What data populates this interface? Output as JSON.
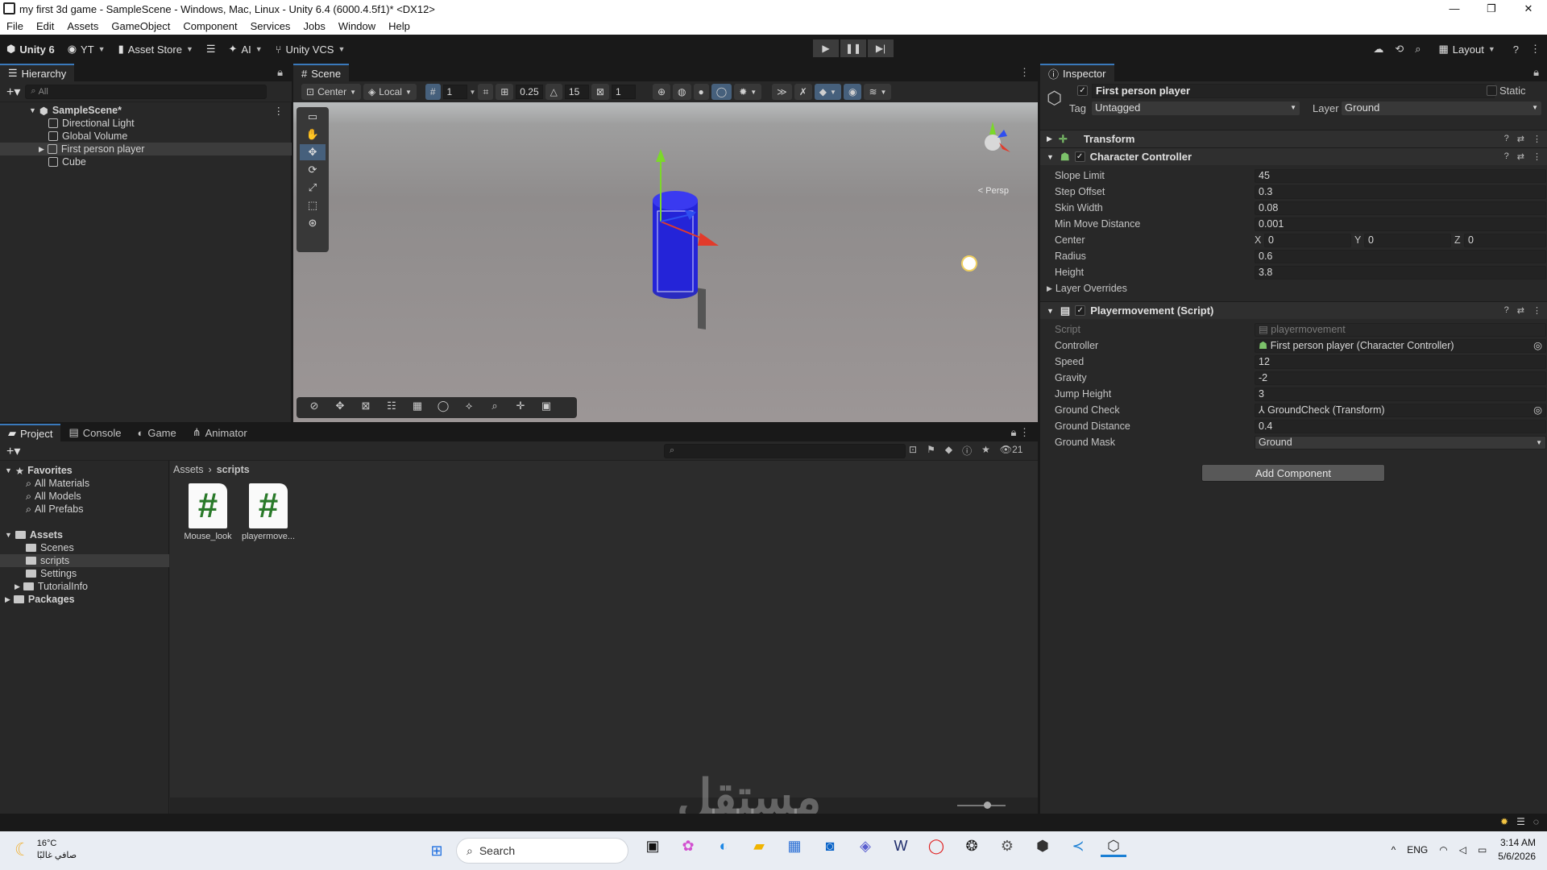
{
  "window": {
    "title": "my first 3d game - SampleScene - Windows, Mac, Linux - Unity 6.4 (6000.4.5f1)* <DX12>",
    "controls": [
      "—",
      "❐",
      "✕"
    ]
  },
  "menu": [
    "File",
    "Edit",
    "Assets",
    "GameObject",
    "Component",
    "Services",
    "Jobs",
    "Window",
    "Help"
  ],
  "toolbar": {
    "unity_label": "Unity 6",
    "account": "YT",
    "asset_store": "Asset Store",
    "ai": "AI",
    "vcs": "Unity VCS",
    "layout": "Layout"
  },
  "hierarchy": {
    "tab": "Hierarchy",
    "search_placeholder": "All",
    "scene": "SampleScene*",
    "items": [
      "Directional Light",
      "Global Volume",
      "First person player",
      "Cube"
    ]
  },
  "scene": {
    "tab": "Scene",
    "pivot": "Center",
    "space": "Local",
    "grid_size": "1",
    "snap_value": "0.25",
    "rotate_snap": "15",
    "scale_snap": "1",
    "persp": "< Persp"
  },
  "inspector": {
    "tab": "Inspector",
    "object_name": "First person player",
    "static_label": "Static",
    "tag_label": "Tag",
    "tag_value": "Untagged",
    "layer_label": "Layer",
    "layer_value": "Ground",
    "transform": "Transform",
    "char_controller": {
      "title": "Character Controller",
      "slope_limit_label": "Slope Limit",
      "slope_limit": "45",
      "step_offset_label": "Step Offset",
      "step_offset": "0.3",
      "skin_width_label": "Skin Width",
      "skin_width": "0.08",
      "min_move_label": "Min Move Distance",
      "min_move": "0.001",
      "center_label": "Center",
      "center_x": "0",
      "center_y": "0",
      "center_z": "0",
      "radius_label": "Radius",
      "radius": "0.6",
      "height_label": "Height",
      "height": "3.8",
      "layer_overrides": "Layer Overrides"
    },
    "player_movement": {
      "title": "Playermovement (Script)",
      "script_label": "Script",
      "script_value": "playermovement",
      "controller_label": "Controller",
      "controller_value": "First person player (Character Controller)",
      "speed_label": "Speed",
      "speed": "12",
      "gravity_label": "Gravity",
      "gravity": "-2",
      "jump_label": "Jump Height",
      "jump": "3",
      "ground_check_label": "Ground Check",
      "ground_check": "GroundCheck (Transform)",
      "ground_distance_label": "Ground Distance",
      "ground_distance": "0.4",
      "ground_mask_label": "Ground Mask",
      "ground_mask": "Ground"
    },
    "add_component": "Add Component"
  },
  "project": {
    "tabs": [
      "Project",
      "Console",
      "Game",
      "Animator"
    ],
    "count": "21",
    "favorites": "Favorites",
    "fav_items": [
      "All Materials",
      "All Models",
      "All Prefabs"
    ],
    "assets": "Assets",
    "asset_folders": [
      "Scenes",
      "scripts",
      "Settings",
      "TutorialInfo"
    ],
    "packages": "Packages",
    "breadcrumb": [
      "Assets",
      "scripts"
    ],
    "files": [
      "Mouse_look",
      "playermove..."
    ]
  },
  "taskbar": {
    "temp": "16°C",
    "weather": "صافي غالبًا",
    "search": "Search",
    "lang": "ENG",
    "time": "3:14 AM",
    "date": "5/6/2026"
  },
  "watermark": "مستقل"
}
